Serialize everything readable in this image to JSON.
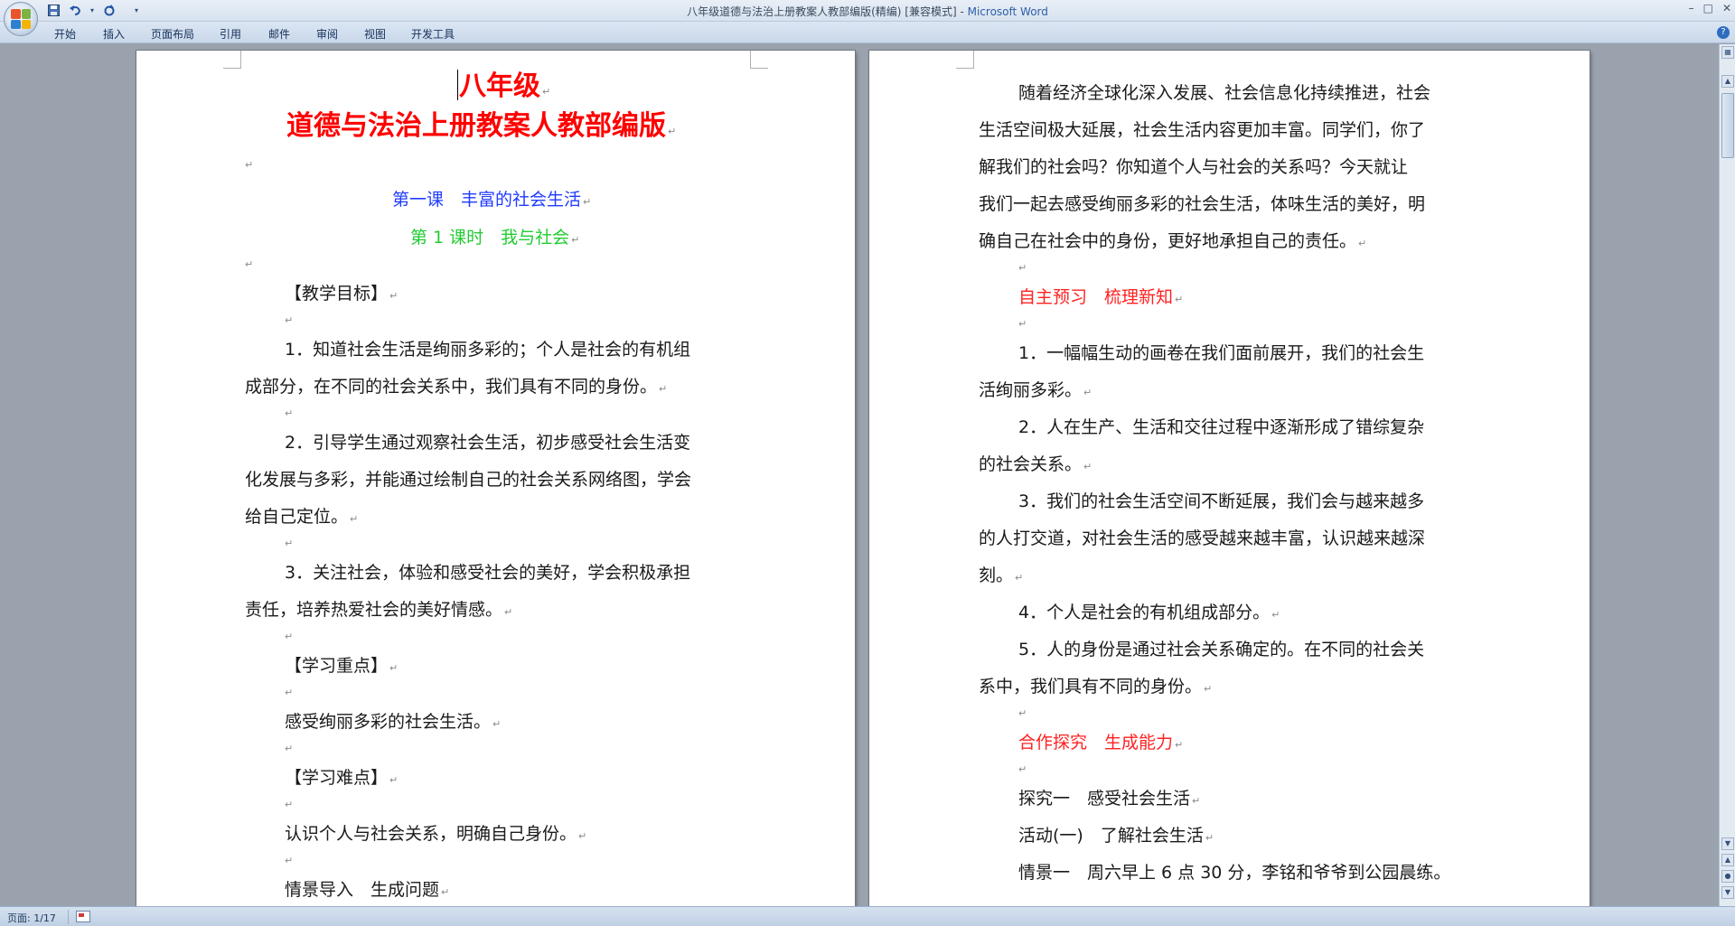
{
  "window": {
    "title": "八年级道德与法治上册教案人教部编版(精编) [兼容模式] - ",
    "app_name": "Microsoft Word"
  },
  "quick_access": {
    "save_icon": "save-icon",
    "undo_icon": "undo-icon",
    "redo_icon": "redo-icon",
    "customize_icon": "customize-icon"
  },
  "ribbon_tabs": [
    "开始",
    "插入",
    "页面布局",
    "引用",
    "邮件",
    "审阅",
    "视图",
    "开发工具"
  ],
  "window_controls": {
    "minimize": "–",
    "maximize": "□",
    "close": "✕"
  },
  "help": "?",
  "paragraph_mark": "↵",
  "left_page": {
    "title_line1": "八年级",
    "title_line2": "道德与法治上册教案人教部编版",
    "lesson": "第一课　丰富的社会生活",
    "period": "第 1 课时　我与社会",
    "objectives_heading": "【教学目标】",
    "obj1_a": "1．知道社会生活是绚丽多彩的；个人是社会的有机组",
    "obj1_b": "成部分，在不同的社会关系中，我们具有不同的身份。",
    "obj2_a": "2．引导学生通过观察社会生活，初步感受社会生活变",
    "obj2_b": "化发展与多彩，并能通过绘制自己的社会关系网络图，学会",
    "obj2_c": "给自己定位。",
    "obj3_a": "3．关注社会，体验和感受社会的美好，学会积极承担",
    "obj3_b": "责任，培养热爱社会的美好情感。",
    "key_heading": "【学习重点】",
    "key_text": "感受绚丽多彩的社会生活。",
    "diff_heading": "【学习难点】",
    "diff_text": "认识个人与社会关系，明确自己身份。",
    "intro": "情景导入　生成问题"
  },
  "right_page": {
    "p1_a": "随着经济全球化深入发展、社会信息化持续推进，社会",
    "p1_b": "生活空间极大延展，社会生活内容更加丰富。同学们，你了",
    "p1_c": "解我们的社会吗？你知道个人与社会的关系吗？今天就让",
    "p1_d": "我们一起去感受绚丽多彩的社会生活，体味生活的美好，明",
    "p1_e": "确自己在社会中的身份，更好地承担自己的责任。",
    "preview_heading": "自主预习　梳理新知",
    "i1_a": "1．一幅幅生动的画卷在我们面前展开，我们的社会生",
    "i1_b": "活绚丽多彩。",
    "i2_a": "2．人在生产、生活和交往过程中逐渐形成了错综复杂",
    "i2_b": "的社会关系。",
    "i3_a": "3．我们的社会生活空间不断延展，我们会与越来越多",
    "i3_b": "的人打交道，对社会生活的感受越来越丰富，认识越来越深",
    "i3_c": "刻。",
    "i4": "4．个人是社会的有机组成部分。",
    "i5_a": "5．人的身份是通过社会关系确定的。在不同的社会关",
    "i5_b": "系中，我们具有不同的身份。",
    "coop_heading": "合作探究　生成能力",
    "explore1": "探究一　感受社会生活",
    "activity1": "活动(一)　了解社会生活",
    "scene1": "情景一　周六早上 6 点 30 分，李铭和爷爷到公园晨练。"
  },
  "status": {
    "page": "页面: 1/17"
  }
}
